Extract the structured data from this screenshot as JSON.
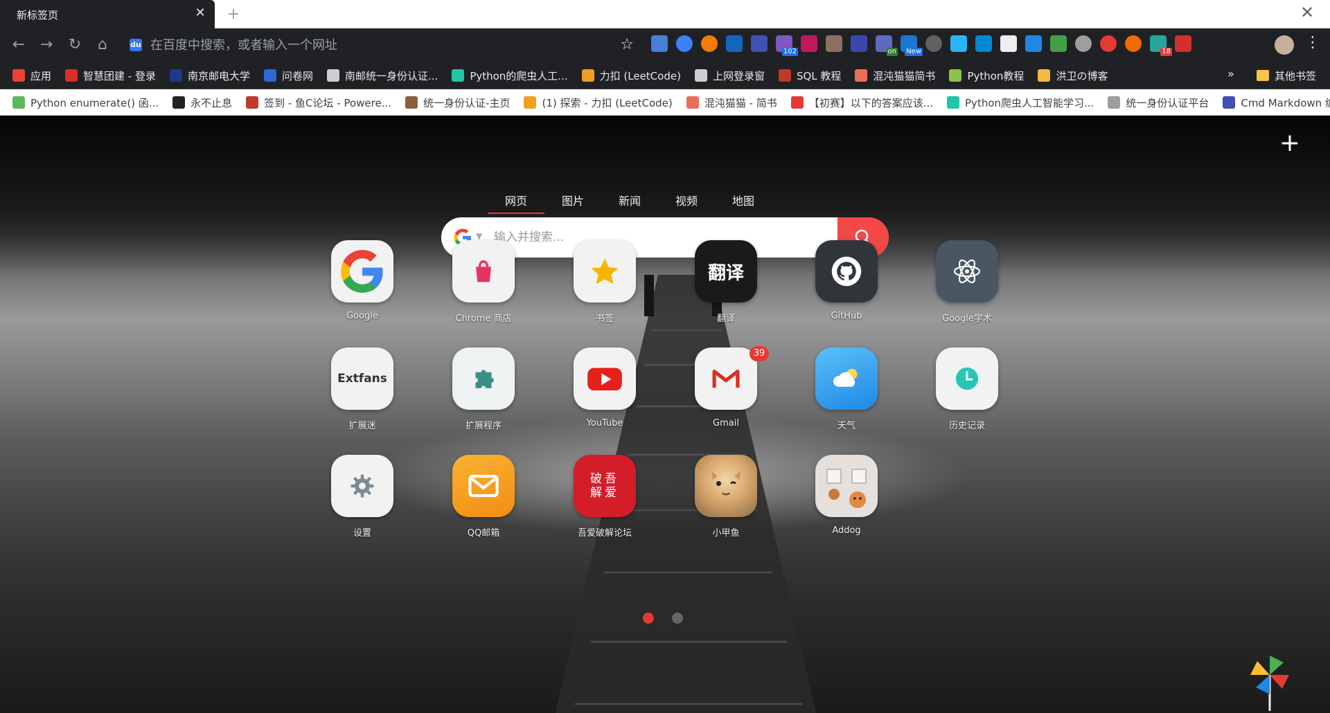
{
  "tab": {
    "title": "新标签页",
    "close": "✕",
    "new_tab": "+"
  },
  "window": {
    "close": "✕"
  },
  "toolbar": {
    "back": "←",
    "forward": "→",
    "reload": "↻",
    "home": "⌂",
    "omnibox_placeholder": "在百度中搜索，或者输入一个网址",
    "engine_icon": "baidu-icon",
    "star": "☆",
    "menu": "⋮",
    "extension_badges": {
      "ext5": "102",
      "ext10": "on",
      "ext11": "New",
      "ext22": "18"
    }
  },
  "bookmarks_bar": {
    "items": [
      {
        "label": "应用",
        "color": "#ea4335"
      },
      {
        "label": "智慧团建 - 登录",
        "color": "#d93025"
      },
      {
        "label": "南京邮电大学",
        "color": "#1a3a8c"
      },
      {
        "label": "问卷网",
        "color": "#2a6ad9"
      },
      {
        "label": "南邮统一身份认证...",
        "color": "#cfcfcf"
      },
      {
        "label": "Python的爬虫人工...",
        "color": "#1fc6a8"
      },
      {
        "label": "力扣 (LeetCode)",
        "color": "#f0a020"
      },
      {
        "label": "上网登录窗",
        "color": "#cfcfcf"
      },
      {
        "label": "SQL 教程",
        "color": "#c0392b"
      },
      {
        "label": "混沌猫猫简书",
        "color": "#ea6f5a"
      },
      {
        "label": "Python教程",
        "color": "#8bc34a"
      },
      {
        "label": "洪卫の博客",
        "color": "#f6b93b"
      }
    ],
    "more": "»",
    "other": "其他书签"
  },
  "bookmarks_bar2": {
    "items": [
      {
        "label": "Python enumerate() 函...",
        "color": "#5cb85c"
      },
      {
        "label": "永不止息",
        "color": "#222222"
      },
      {
        "label": "签到 - 鱼C论坛 - Powere...",
        "color": "#c0392b"
      },
      {
        "label": "统一身份认证-主页",
        "color": "#8b5e3c"
      },
      {
        "label": "(1) 探索 - 力扣 (LeetCode)",
        "color": "#f0a020"
      },
      {
        "label": "混沌猫猫 - 简书",
        "color": "#ea6f5a"
      },
      {
        "label": "【初赛】以下的答案应该...",
        "color": "#e53935"
      },
      {
        "label": "Python爬虫人工智能学习...",
        "color": "#1fc6a8"
      },
      {
        "label": "统一身份认证平台",
        "color": "#9e9e9e"
      },
      {
        "label": "Cmd Markdown 编辑",
        "color": "#3f51b5"
      }
    ]
  },
  "search": {
    "tabs": [
      "网页",
      "图片",
      "新闻",
      "视频",
      "地图"
    ],
    "active_tab": 0,
    "placeholder": "输入并搜索...",
    "button_color": "#f24848"
  },
  "apps": [
    {
      "name": "Google",
      "icon": "google-icon"
    },
    {
      "name": "Chrome 商店",
      "icon": "chrome-store-icon"
    },
    {
      "name": "书签",
      "icon": "bookmark-star-icon"
    },
    {
      "name": "翻译",
      "icon": "translate-icon",
      "glyph": "翻译"
    },
    {
      "name": "GitHub",
      "icon": "github-icon"
    },
    {
      "name": "Google学术",
      "icon": "scholar-atom-icon"
    },
    {
      "name": "扩展迷",
      "icon": "extfans-icon",
      "glyph": "Extfans"
    },
    {
      "name": "扩展程序",
      "icon": "puzzle-icon"
    },
    {
      "name": "YouTube",
      "icon": "youtube-icon"
    },
    {
      "name": "Gmail",
      "icon": "gmail-icon",
      "badge": "39"
    },
    {
      "name": "天气",
      "icon": "weather-icon"
    },
    {
      "name": "历史记录",
      "icon": "history-clock-icon"
    },
    {
      "name": "设置",
      "icon": "gear-icon"
    },
    {
      "name": "QQ邮箱",
      "icon": "qqmail-icon"
    },
    {
      "name": "吾爱破解论坛",
      "icon": "52pojie-icon",
      "glyph": "破吾解爱"
    },
    {
      "name": "小甲鱼",
      "icon": "cat-avatar-icon"
    },
    {
      "name": "Addog",
      "icon": "addog-icon"
    }
  ],
  "pager": {
    "pages": 2,
    "active": 0
  }
}
